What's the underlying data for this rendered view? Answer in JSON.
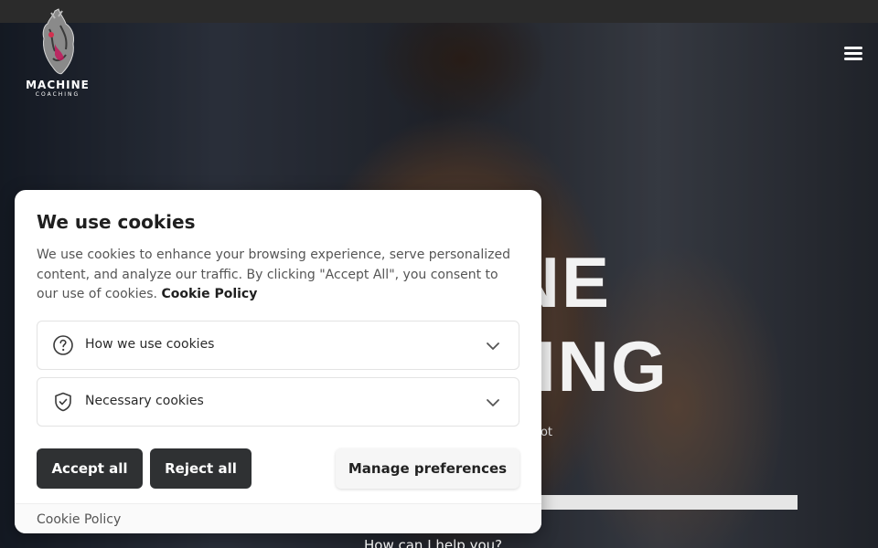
{
  "header": {
    "logo_title": "MACHINE",
    "logo_subtitle": "COACHING"
  },
  "hero": {
    "title_line1": "MACHINE",
    "title_line2": "COACHING",
    "subtitle": "ot",
    "help_text": "How can I help you?"
  },
  "cookie_banner": {
    "title": "We use cookies",
    "description": "We use cookies to enhance your browsing experience, serve personalized content, and analyze our traffic. By clicking \"Accept All\", you consent to our use of cookies.",
    "policy_link": "Cookie Policy",
    "sections": [
      {
        "label": "How we use cookies",
        "icon": "question-circle-icon"
      },
      {
        "label": "Necessary cookies",
        "icon": "shield-check-icon"
      }
    ],
    "accept_label": "Accept all",
    "reject_label": "Reject all",
    "manage_label": "Manage preferences",
    "footer_link": "Cookie Policy"
  },
  "colors": {
    "button_dark": "#2f3133",
    "topbar": "#2b2b2b"
  }
}
